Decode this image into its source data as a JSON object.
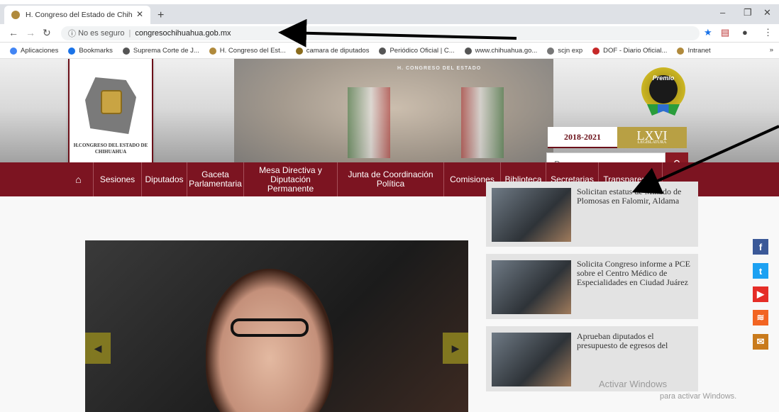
{
  "browser": {
    "tab_title": "H. Congreso del Estado de Chihu",
    "address_security": "No es seguro",
    "address_url": "congresochihuahua.gob.mx",
    "bookmarks": [
      {
        "label": "Aplicaciones",
        "color": "#4285f4"
      },
      {
        "label": "Bookmarks",
        "color": "#1a73e8"
      },
      {
        "label": "Suprema Corte de J...",
        "color": "#555555"
      },
      {
        "label": "H. Congreso del Est...",
        "color": "#b08a3c"
      },
      {
        "label": "camara de diputados",
        "color": "#8a6b1c"
      },
      {
        "label": "Periódico Oficial | C...",
        "color": "#555555"
      },
      {
        "label": "www.chihuahua.go...",
        "color": "#555555"
      },
      {
        "label": "scjn exp",
        "color": "#777777"
      },
      {
        "label": "DOF - Diario Oficial...",
        "color": "#c62828"
      },
      {
        "label": "Intranet",
        "color": "#b08a3c"
      }
    ]
  },
  "header": {
    "banner_text": "H. CONGRESO DEL ESTADO",
    "logo_name": "H.CONGRESO DEL ESTADO DE CHIHUAHUA",
    "premio": "Premio",
    "years": "2018-2021",
    "legislatura": "LXVI",
    "legislatura_sub": "LEGISLATURA",
    "search_placeholder": "Buscar ..."
  },
  "nav": {
    "items": [
      "Sesiones",
      "Diputados",
      "Gaceta Parlamentaria",
      "Mesa Directiva y Diputación Permanente",
      "Junta de Coordinación Política",
      "Comisiones",
      "Biblioteca",
      "Secretarias",
      "Transparencia"
    ]
  },
  "news": [
    "Solicitan estatus de Minado de Plomosas en Falomir, Aldama",
    "Solicita Congreso informe a PCE sobre el Centro Médico de Especialidades en Ciudad Juárez",
    "Aprueban diputados el presupuesto de egresos del"
  ],
  "social": [
    {
      "icon": "facebook-icon",
      "glyph": "f",
      "color": "#3b5998"
    },
    {
      "icon": "twitter-icon",
      "glyph": "t",
      "color": "#1da1f2"
    },
    {
      "icon": "youtube-icon",
      "glyph": "▶",
      "color": "#e52d27"
    },
    {
      "icon": "rss-icon",
      "glyph": "≋",
      "color": "#f26522"
    },
    {
      "icon": "mail-icon",
      "glyph": "✉",
      "color": "#c97b1c"
    }
  ],
  "watermark": {
    "title": "Activar Windows",
    "sub": "para activar Windows."
  },
  "colors": {
    "brand_maroon": "#7c1421",
    "gold": "#b8a044"
  }
}
